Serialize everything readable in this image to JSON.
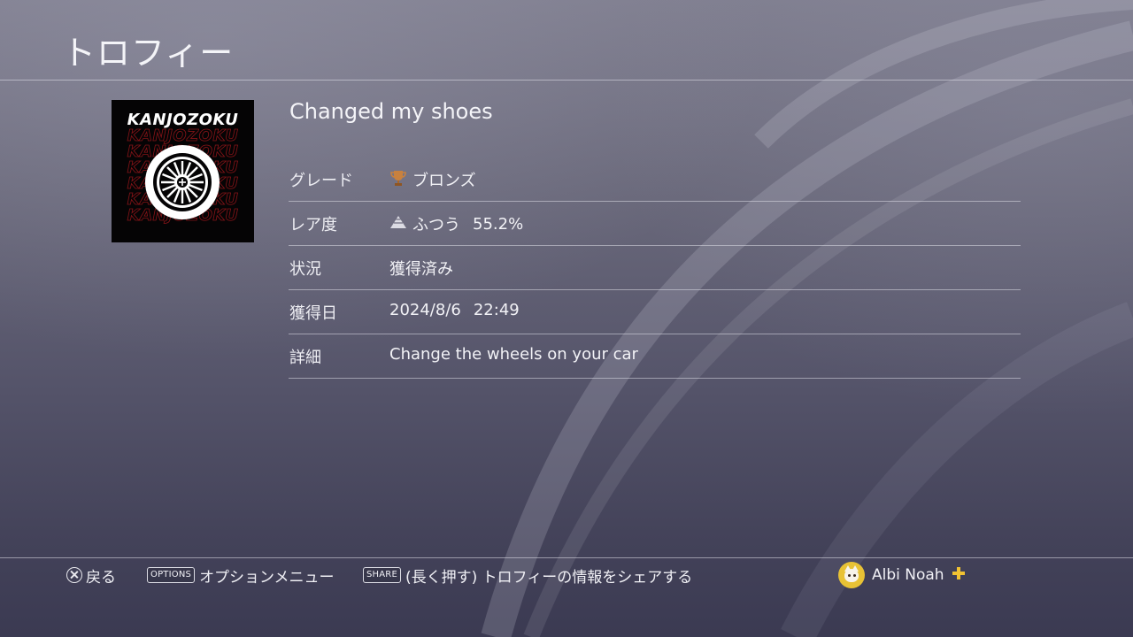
{
  "header": {
    "title": "トロフィー"
  },
  "trophy": {
    "art_text": "KANJOZOKU",
    "name": "Changed my shoes",
    "rows": [
      {
        "label": "グレード",
        "value": "ブロンズ",
        "icon": "bronze-trophy-icon"
      },
      {
        "label": "レア度",
        "value": "ふつう",
        "extra": "55.2%",
        "icon": "rarity-pyramid-icon"
      },
      {
        "label": "状況",
        "value": "獲得済み"
      },
      {
        "label": "獲得日",
        "value": "2024/8/6",
        "extra": "22:49"
      },
      {
        "label": "詳細",
        "value": "Change the wheels on your car"
      }
    ]
  },
  "footer": {
    "back_label": "戻る",
    "back_icon": "cross-button-icon",
    "options_key": "OPTIONS",
    "options_label": "オプションメニュー",
    "share_key": "SHARE",
    "share_label": "(長く押す) トロフィーの情報をシェアする",
    "user_name": "Albi Noah",
    "plus_icon": "playstation-plus-icon"
  },
  "colors": {
    "bronze": "#c8813e",
    "plus_gold": "#f1c232",
    "avatar_bg": "#e8c235",
    "art_red": "#8a1418"
  }
}
